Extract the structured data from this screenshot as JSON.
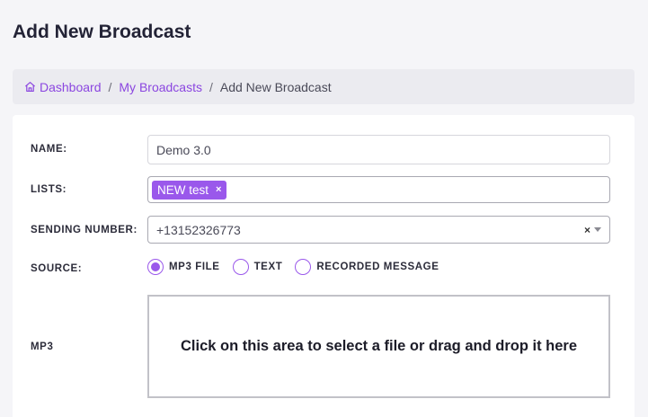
{
  "page": {
    "title": "Add New Broadcast"
  },
  "breadcrumb": {
    "home_icon": "home-icon",
    "items": [
      {
        "label": "Dashboard"
      },
      {
        "label": "My Broadcasts"
      },
      {
        "label": "Add New Broadcast"
      }
    ],
    "separator": "/"
  },
  "form": {
    "name": {
      "label": "NAME:",
      "value": "Demo 3.0"
    },
    "lists": {
      "label": "LISTS:",
      "tags": [
        "NEW test"
      ],
      "tag_remove": "×"
    },
    "sending_number": {
      "label": "SENDING NUMBER:",
      "value": "+13152326773",
      "clear": "×"
    },
    "source": {
      "label": "SOURCE:",
      "options": [
        {
          "label": "MP3 FILE",
          "selected": true
        },
        {
          "label": "TEXT",
          "selected": false
        },
        {
          "label": "RECORDED MESSAGE",
          "selected": false
        }
      ]
    },
    "mp3": {
      "label": "MP3",
      "dropzone_text": "Click on this area to select a file or drag and drop it here"
    }
  },
  "colors": {
    "accent": "#9a58eb",
    "link": "#8b46e0"
  }
}
